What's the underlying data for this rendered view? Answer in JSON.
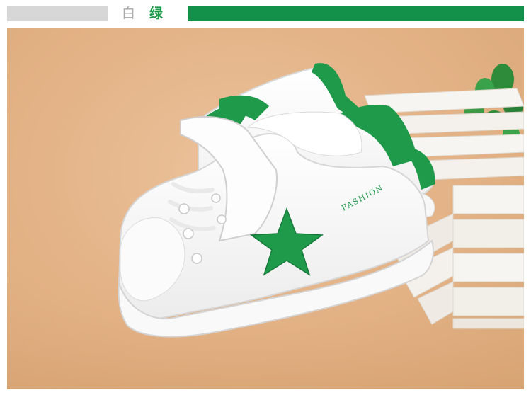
{
  "header": {
    "label_white": "白",
    "label_green": "绿",
    "accent_color": "#13914a",
    "bar_gray_color": "#d7d7d7"
  },
  "photo": {
    "brand_print": "FASHION",
    "shoe_primary_color": "#ffffff",
    "shoe_accent_color": "#1f9a4b",
    "background_color": "#e3b286",
    "crate_color": "#f5f3ef",
    "plant_color": "#2e8b3a"
  }
}
